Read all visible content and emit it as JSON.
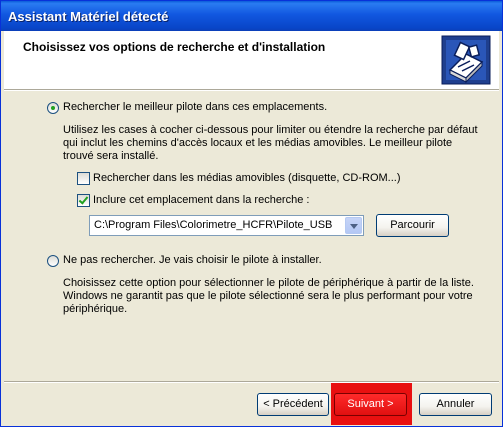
{
  "window": {
    "title": "Assistant Matériel détecté"
  },
  "header": {
    "title": "Choisissez vos options de recherche et d'installation",
    "icon": "hardware-icon"
  },
  "options": {
    "search_best": {
      "label": "Rechercher le meilleur pilote dans ces emplacements.",
      "checked": true,
      "description": "Utilisez les cases à cocher ci-dessous pour limiter ou étendre la recherche par défaut qui inclut les chemins d'accès locaux et les médias amovibles. Le meilleur pilote trouvé sera installé."
    },
    "removable_media": {
      "label": "Rechercher dans les médias amovibles (disquette, CD-ROM...)",
      "checked": false
    },
    "include_location": {
      "label": "Inclure cet emplacement dans la recherche :",
      "checked": true
    },
    "path": {
      "value": "C:\\Program Files\\Colorimetre_HCFR\\Pilote_USB"
    },
    "browse_label": "Parcourir",
    "no_search": {
      "label": "Ne pas rechercher. Je vais choisir le pilote à installer.",
      "checked": false,
      "description": "Choisissez cette option pour sélectionner le pilote de périphérique à partir de la liste. Windows ne garantit pas que le pilote sélectionné sera le plus performant pour votre périphérique."
    }
  },
  "buttons": {
    "back": "< Précédent",
    "next": "Suivant >",
    "cancel": "Annuler"
  },
  "colors": {
    "titlebar": "#0845c8",
    "highlight": "#e81010",
    "accent_check": "#21a121"
  }
}
